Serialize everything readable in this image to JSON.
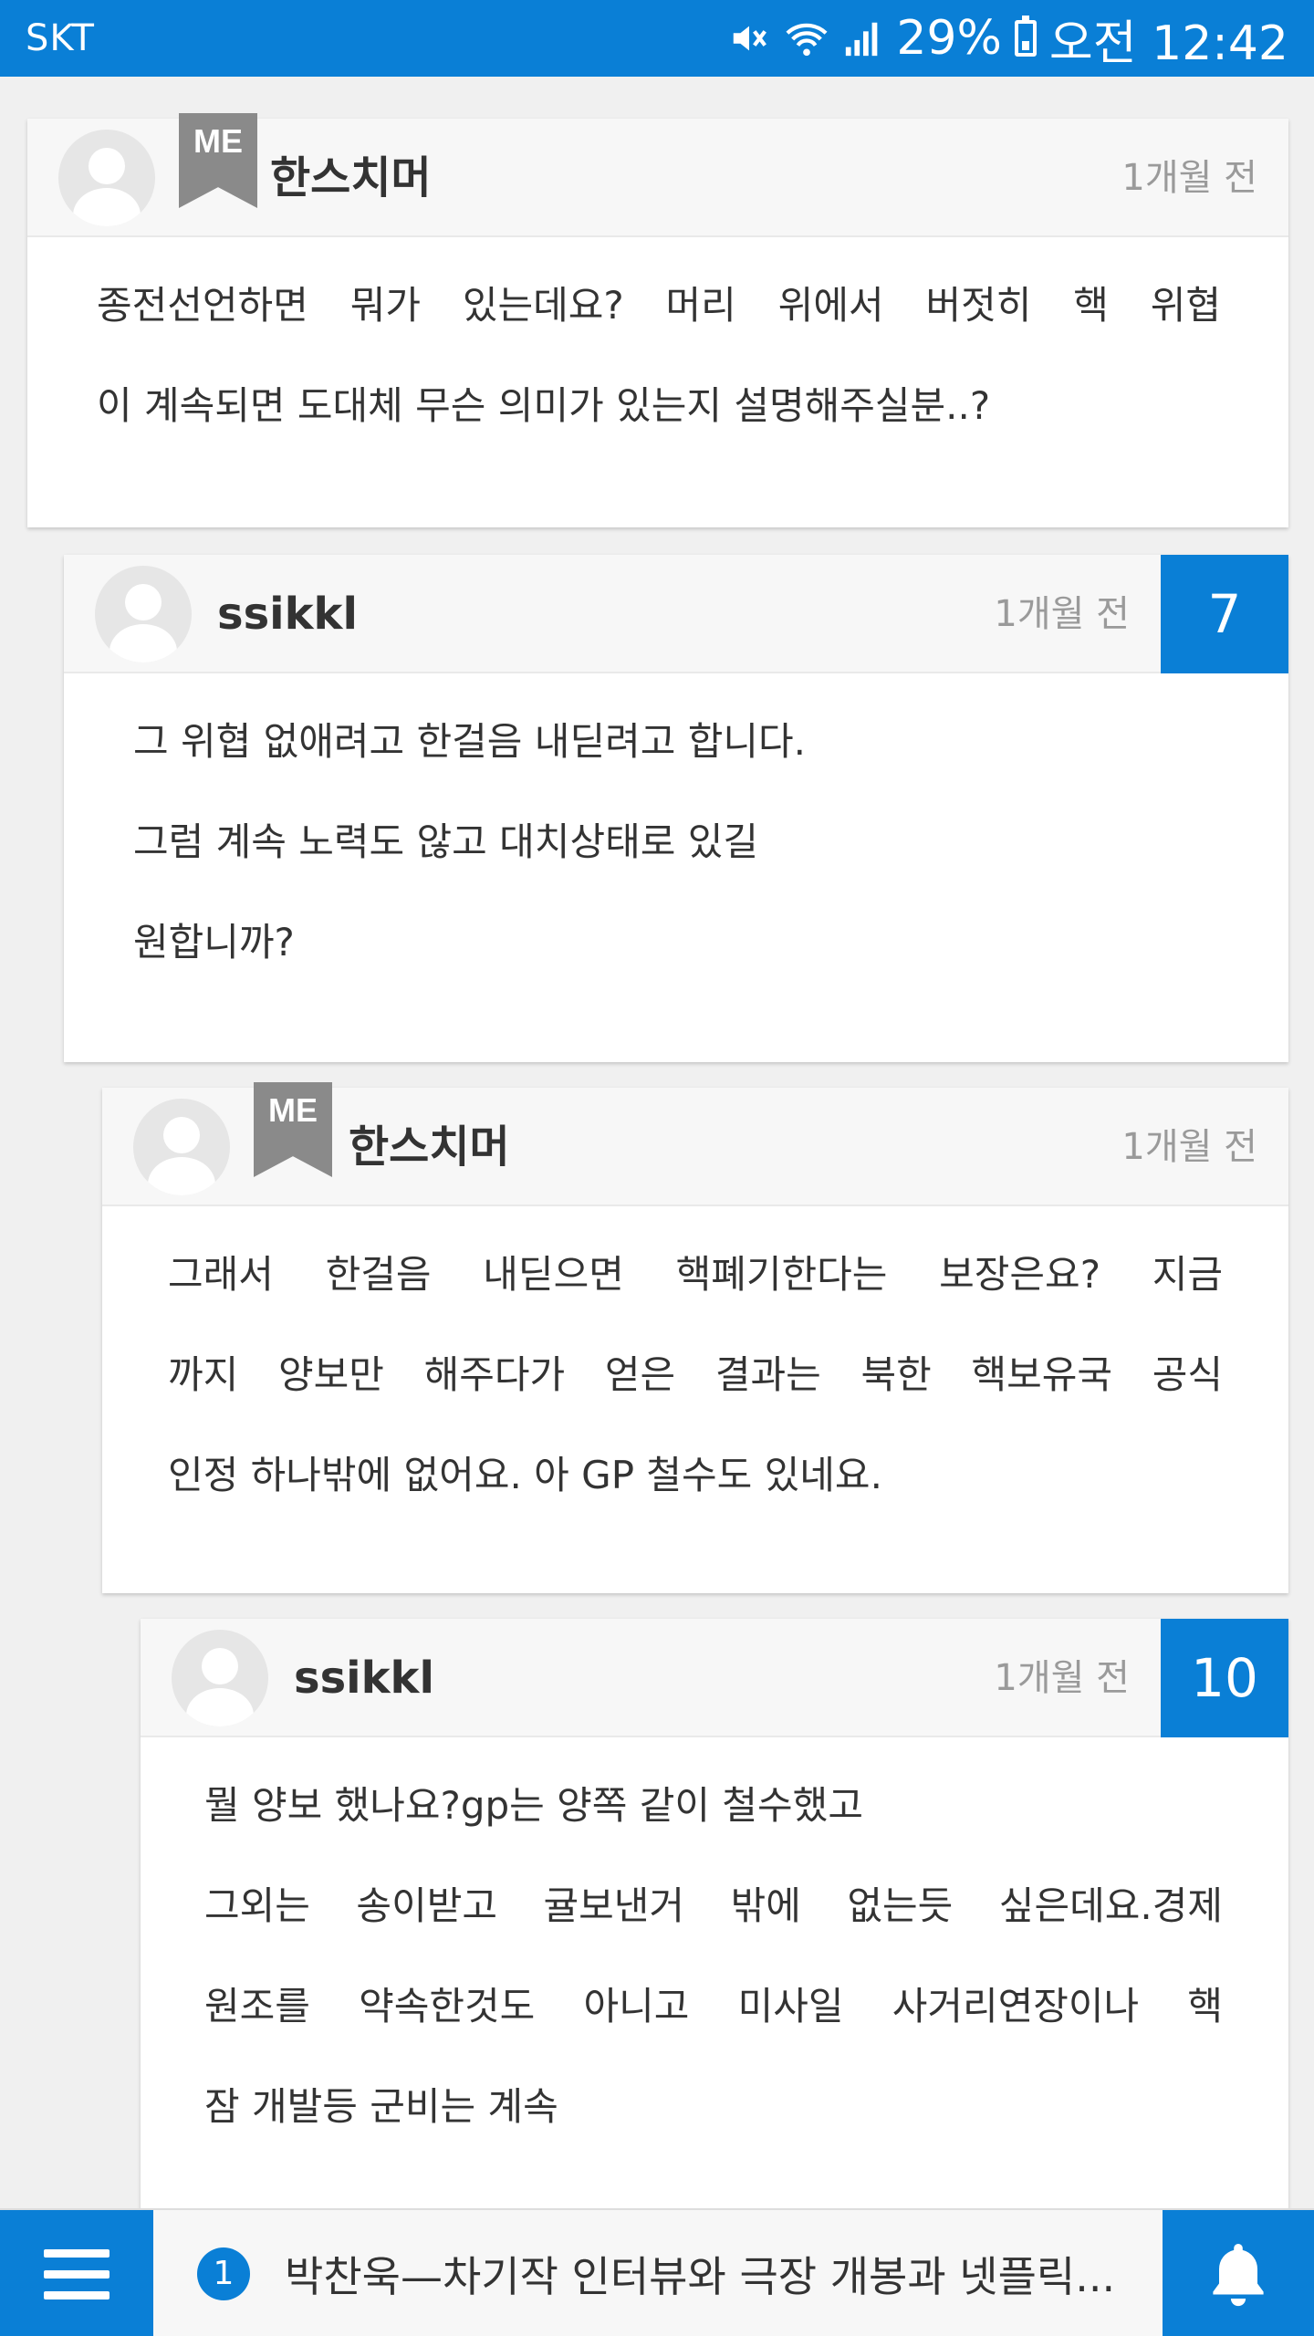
{
  "status_bar": {
    "carrier": "SKT",
    "battery": "29%",
    "time": "오전 12:42"
  },
  "comments": [
    {
      "username": "한스치머",
      "me_badge": "ME",
      "timestamp": "1개월 전",
      "lines": [
        "종전선언하면 뭐가 있는데요? 머리 위에서 버젓히 핵 위협",
        "이 계속되면 도대체 무슨 의미가 있는지 설명해주실분..?"
      ]
    },
    {
      "username": "ssikkl",
      "timestamp": "1개월 전",
      "votes": "7",
      "lines": [
        "그 위협 없애려고 한걸음 내딛려고 합니다.",
        "그럼 계속 노력도 않고 대치상태로 있길",
        "원합니까?"
      ]
    },
    {
      "username": "한스치머",
      "me_badge": "ME",
      "timestamp": "1개월 전",
      "lines": [
        "그래서 한걸음 내딛으면 핵폐기한다는 보장은요? 지금",
        "까지 양보만 해주다가 얻은 결과는 북한 핵보유국 공식",
        "인정 하나밖에 없어요. 아 GP 철수도 있네요."
      ]
    },
    {
      "username": "ssikkl",
      "timestamp": "1개월 전",
      "votes": "10",
      "lines": [
        "뭘 양보 했나요?gp는 양쪽 같이 철수했고",
        "그외는 송이받고 귤보낸거 밖에 없는듯 싶은데요.경제",
        "원조를 약속한것도 아니고 미사일 사거리연장이나 핵",
        "잠 개발등 군비는 계속"
      ]
    }
  ],
  "bottom_bar": {
    "notice_count": "1",
    "notice_text": "박찬욱—차기작 인터뷰와 극장 개봉과 넷플릭..."
  }
}
